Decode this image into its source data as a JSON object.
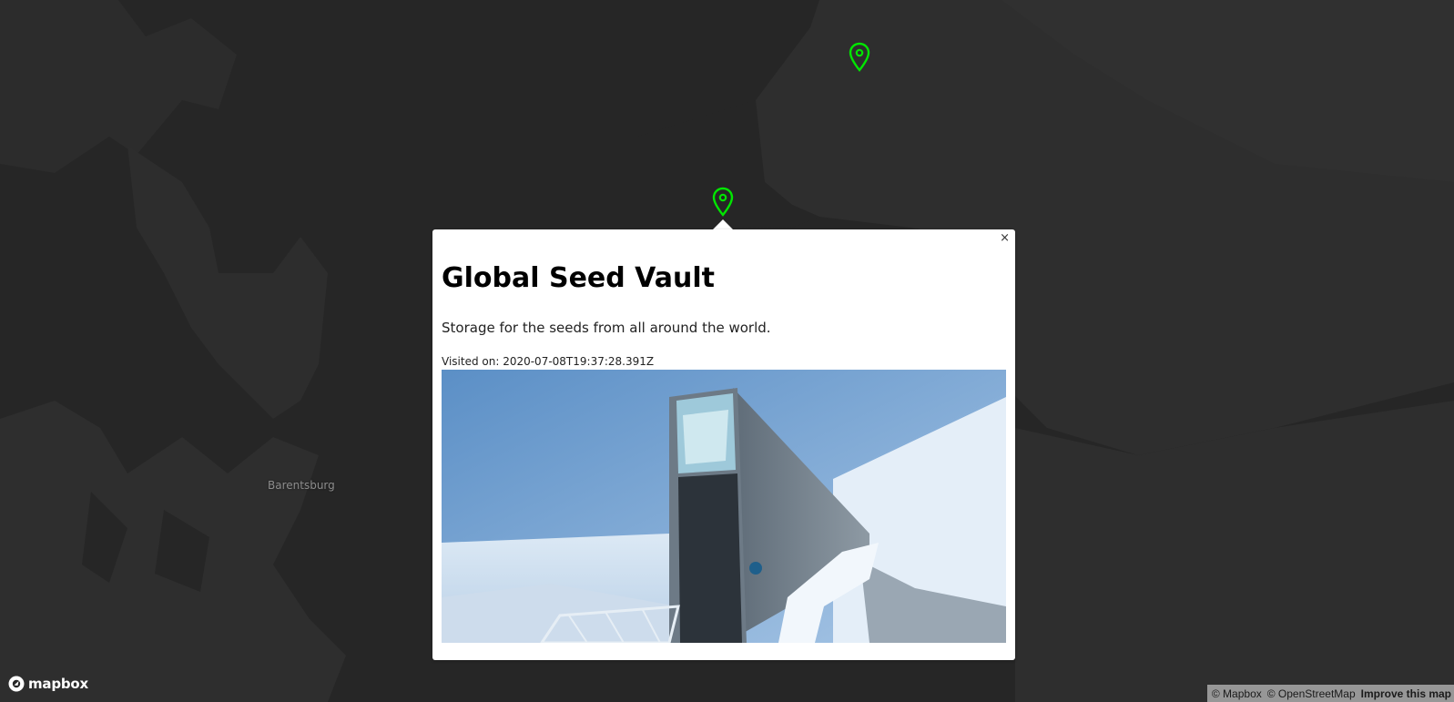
{
  "map": {
    "place_label": "Barentsburg",
    "marker_color": "#00e600",
    "land_color": "#2f2f2f",
    "water_color": "#262626"
  },
  "popup": {
    "close_label": "×",
    "title": "Global Seed Vault",
    "description": "Storage for the seeds from all around the world.",
    "visited_text": "Visited on: 2020-07-08T19:37:28.391Z"
  },
  "footer": {
    "logo_text": "mapbox",
    "attribution_mapbox": "© Mapbox",
    "attribution_osm": "© OpenStreetMap",
    "improve_link": "Improve this map"
  }
}
